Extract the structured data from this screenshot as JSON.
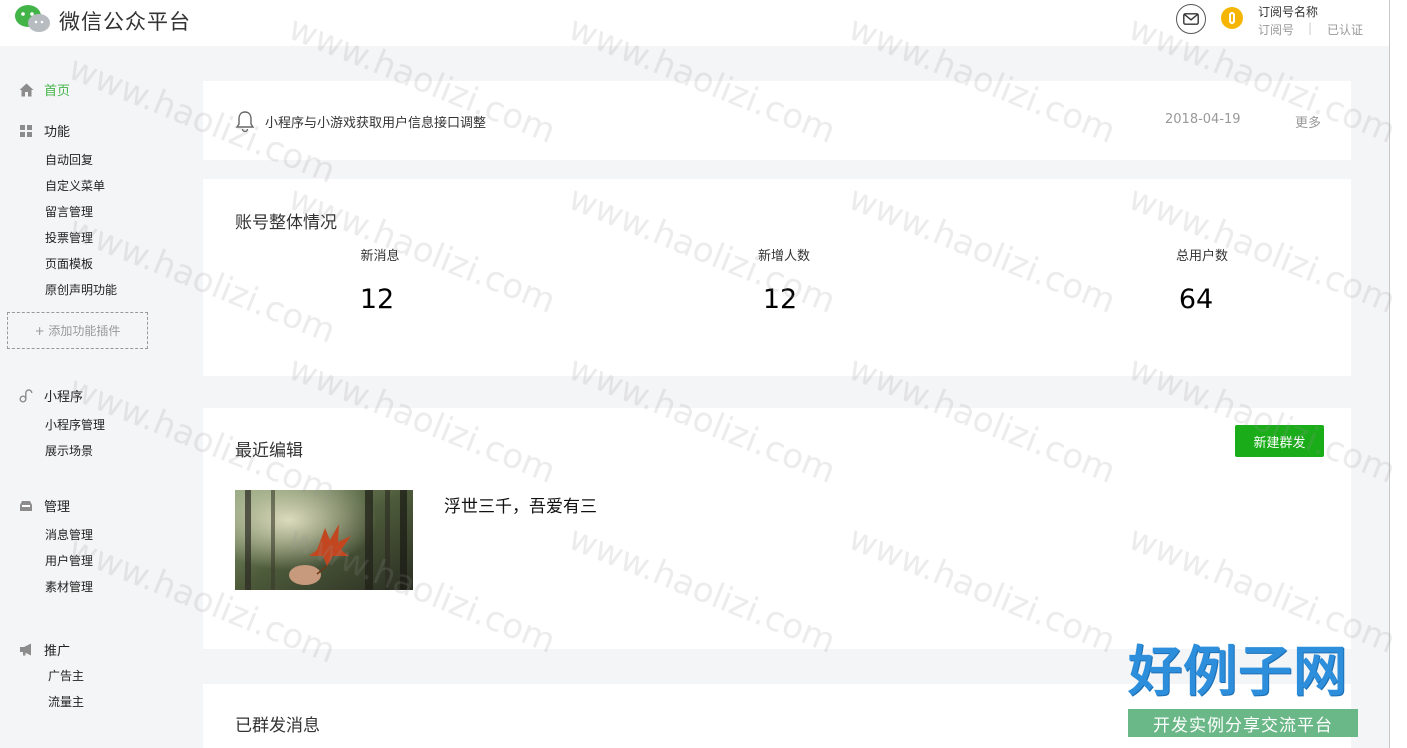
{
  "header": {
    "app_title": "微信公众平台",
    "account_name": "订阅号名称",
    "account_type": "订阅号",
    "separator": "|",
    "verified": "已认证"
  },
  "sidebar": {
    "home": "首页",
    "groups": [
      {
        "label": "功能",
        "items": [
          "自动回复",
          "自定义菜单",
          "留言管理",
          "投票管理",
          "页面模板",
          "原创声明功能"
        ]
      },
      {
        "label": "小程序",
        "items": [
          "小程序管理",
          "展示场景"
        ]
      },
      {
        "label": "管理",
        "items": [
          "消息管理",
          "用户管理",
          "素材管理"
        ]
      },
      {
        "label": "推广",
        "items": [
          "广告主",
          "流量主"
        ]
      }
    ],
    "add_plugin": "+ 添加功能插件"
  },
  "notice": {
    "text": "小程序与小游戏获取用户信息接口调整",
    "date": "2018-04-19",
    "more": "更多"
  },
  "overview": {
    "title": "账号整体情况",
    "stats": [
      {
        "label": "新消息",
        "value": "12"
      },
      {
        "label": "新增人数",
        "value": "12"
      },
      {
        "label": "总用户数",
        "value": "64"
      }
    ]
  },
  "recent": {
    "title": "最近编辑",
    "new_button": "新建群发",
    "article_title": "浮世三千，吾爱有三"
  },
  "sent": {
    "title": "已群发消息"
  },
  "watermark": {
    "text": "www.haolizi.com",
    "brand_title": "好例子网",
    "brand_subtitle": "开发实例分享交流平台"
  },
  "colors": {
    "accent_green": "#44b549",
    "button_green": "#1aad19",
    "coin_yellow": "#f6b502",
    "brand_blue": "#2d8fdc"
  }
}
